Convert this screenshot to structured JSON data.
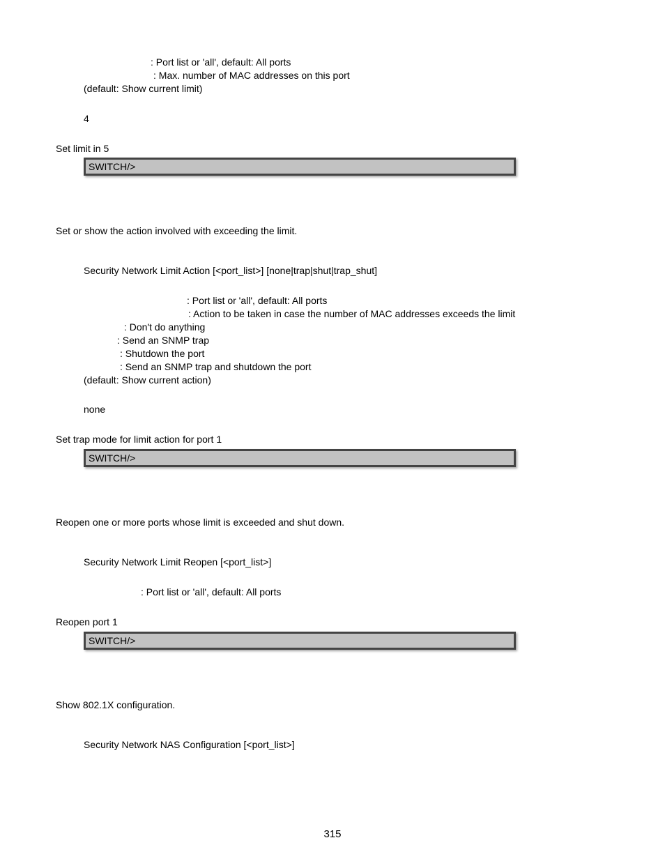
{
  "section_limit": {
    "param1": ": Port list or 'all', default: All ports",
    "param2": ": Max. number of MAC addresses on this port",
    "default_line": "(default: Show current limit)",
    "default_value": "4",
    "example_label": "Set limit in 5",
    "cli": "SWITCH/>"
  },
  "section_action": {
    "desc": "Set or show the action involved with exceeding the limit.",
    "syntax": "Security Network Limit Action [<port_list>] [none|trap|shut|trap_shut]",
    "param1": ": Port list or 'all', default: All ports",
    "param2": ": Action to be taken in case the number of MAC addresses exceeds the limit",
    "opt_none": ": Don't do anything",
    "opt_trap": ": Send an SNMP trap",
    "opt_shut": ": Shutdown the port",
    "opt_trap_shut": ": Send an SNMP trap and shutdown the port",
    "default_line": "(default: Show current action)",
    "default_value": "none",
    "example_label": "Set trap mode for limit action for port 1",
    "cli": "SWITCH/>"
  },
  "section_reopen": {
    "desc": "Reopen one or more ports whose limit is exceeded and shut down.",
    "syntax": "Security Network Limit Reopen [<port_list>]",
    "param1": ": Port list or 'all', default: All ports",
    "example_label": "Reopen port 1",
    "cli": "SWITCH/>"
  },
  "section_nas": {
    "desc": "Show 802.1X configuration.",
    "syntax": "Security Network NAS Configuration [<port_list>]"
  },
  "page_number": "315"
}
